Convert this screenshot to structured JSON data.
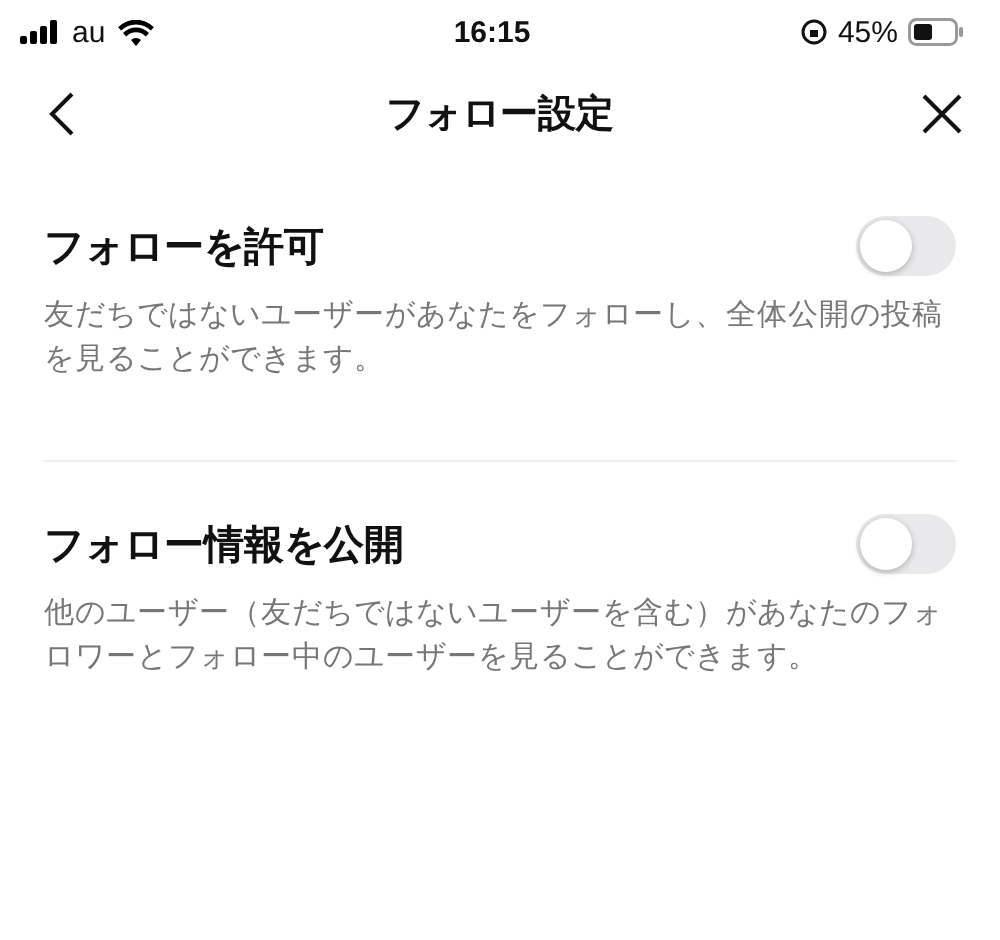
{
  "status_bar": {
    "carrier": "au",
    "time": "16:15",
    "battery": "45%"
  },
  "nav": {
    "title": "フォロー設定"
  },
  "settings": [
    {
      "label": "フォローを許可",
      "description": "友だちではないユーザーがあなたをフォローし、全体公開の投稿を見ることができます。",
      "on": false
    },
    {
      "label": "フォロー情報を公開",
      "description": "他のユーザー（友だちではないユーザーを含む）があなたのフォロワーとフォロー中のユーザーを見ることができます。",
      "on": false
    }
  ]
}
